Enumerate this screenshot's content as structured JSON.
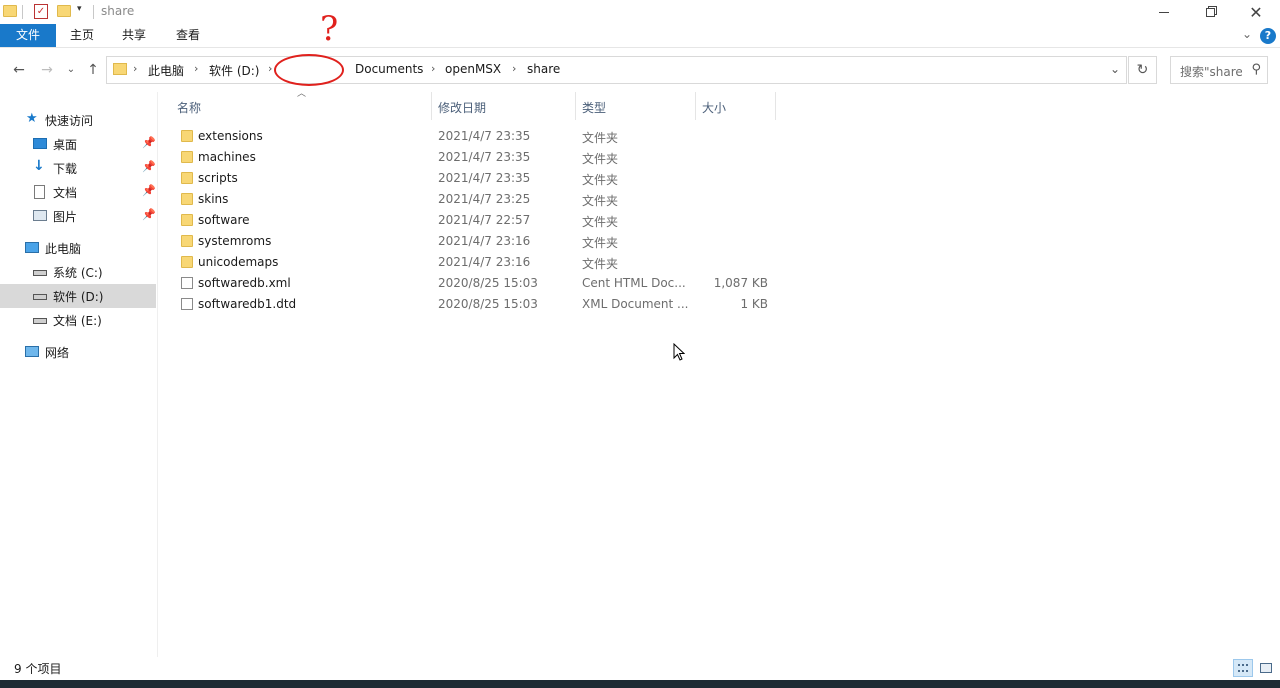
{
  "window": {
    "title": "share"
  },
  "ribbon": {
    "tabs": [
      "文件",
      "主页",
      "共享",
      "查看"
    ],
    "help": "?"
  },
  "address_bar": {
    "crumbs": [
      "此电脑",
      "软件 (D:)",
      "Documents",
      "openMSX",
      "share"
    ]
  },
  "search": {
    "placeholder": "搜索\"share\""
  },
  "annotation": {
    "mark": "?"
  },
  "sidebar": {
    "quick_access": "快速访问",
    "quick_items": [
      "桌面",
      "下载",
      "文档",
      "图片"
    ],
    "this_pc": "此电脑",
    "drives": [
      "系统 (C:)",
      "软件 (D:)",
      "文档 (E:)"
    ],
    "selected_drive": "软件 (D:)",
    "network": "网络"
  },
  "columns": {
    "name": "名称",
    "date": "修改日期",
    "type": "类型",
    "size": "大小"
  },
  "files": [
    {
      "name": "extensions",
      "date": "2021/4/7 23:35",
      "type": "文件夹",
      "size": "",
      "kind": "folder"
    },
    {
      "name": "machines",
      "date": "2021/4/7 23:35",
      "type": "文件夹",
      "size": "",
      "kind": "folder"
    },
    {
      "name": "scripts",
      "date": "2021/4/7 23:35",
      "type": "文件夹",
      "size": "",
      "kind": "folder"
    },
    {
      "name": "skins",
      "date": "2021/4/7 23:25",
      "type": "文件夹",
      "size": "",
      "kind": "folder"
    },
    {
      "name": "software",
      "date": "2021/4/7 22:57",
      "type": "文件夹",
      "size": "",
      "kind": "folder"
    },
    {
      "name": "systemroms",
      "date": "2021/4/7 23:16",
      "type": "文件夹",
      "size": "",
      "kind": "folder"
    },
    {
      "name": "unicodemaps",
      "date": "2021/4/7 23:16",
      "type": "文件夹",
      "size": "",
      "kind": "folder"
    },
    {
      "name": "softwaredb.xml",
      "date": "2020/8/25 15:03",
      "type": "Cent HTML Doc...",
      "size": "1,087 KB",
      "kind": "file"
    },
    {
      "name": "softwaredb1.dtd",
      "date": "2020/8/25 15:03",
      "type": "XML Document ...",
      "size": "1 KB",
      "kind": "file"
    }
  ],
  "status": {
    "item_count": "9 个项目"
  },
  "colors": {
    "accent": "#1979ca",
    "folder": "#f8d775",
    "annotation": "#e0211d",
    "selection": "#d9d9d9"
  }
}
